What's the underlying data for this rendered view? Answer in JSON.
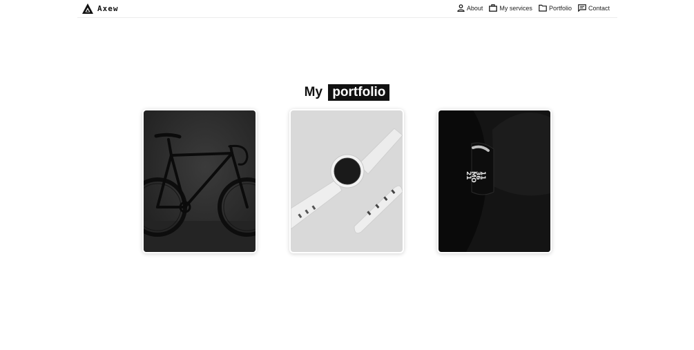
{
  "brand": {
    "name": "Axew",
    "logo_icon": "triangle-logo-icon"
  },
  "nav": {
    "items": [
      {
        "label": "About",
        "icon": "person-icon"
      },
      {
        "label": "My services",
        "icon": "briefcase-icon"
      },
      {
        "label": "Portfolio",
        "icon": "folder-icon"
      },
      {
        "label": "Contact",
        "icon": "chat-icon"
      }
    ]
  },
  "portfolio": {
    "heading_prefix": "My",
    "heading_highlight": "portfolio",
    "items": [
      {
        "subject": "bicycle",
        "background": "#2b2b2b"
      },
      {
        "subject": "smartwatch",
        "background": "#d9d9d9"
      },
      {
        "subject": "fitness-band",
        "background": "#0a0a0a"
      }
    ]
  },
  "colors": {
    "text": "#111111",
    "highlight_bg": "#111111",
    "highlight_text": "#ffffff"
  }
}
